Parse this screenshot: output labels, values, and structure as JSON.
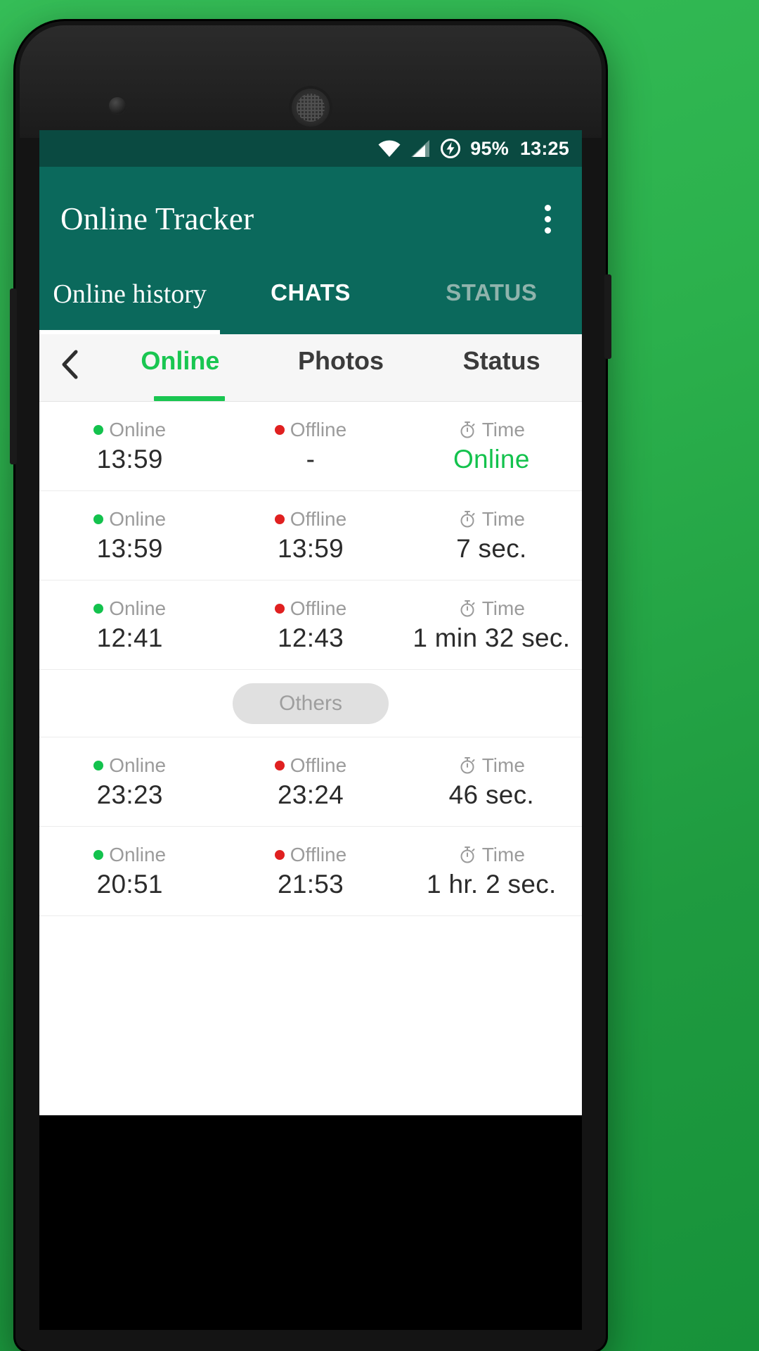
{
  "status_bar": {
    "wifi_icon": "wifi-icon",
    "signal_icon": "cellular-signal-icon",
    "charging_icon": "battery-charging-icon",
    "battery_percent": "95%",
    "clock": "13:25"
  },
  "app_bar": {
    "title": "Online Tracker",
    "overflow_icon": "overflow-menu-icon"
  },
  "primary_tabs": {
    "items": [
      {
        "label": "Online history",
        "active": true
      },
      {
        "label": "CHATS",
        "active": false
      },
      {
        "label": "STATUS",
        "active": false
      }
    ]
  },
  "sub_tabs": {
    "back_icon": "back-chevron-icon",
    "items": [
      {
        "label": "Online",
        "active": true
      },
      {
        "label": "Photos",
        "active": false
      },
      {
        "label": "Status",
        "active": false
      }
    ]
  },
  "columns": {
    "online_label": "Online",
    "offline_label": "Offline",
    "time_label": "Time",
    "online_icon": "green-dot-icon",
    "offline_icon": "red-dot-icon",
    "time_icon": "stopwatch-icon"
  },
  "history": {
    "rows": [
      {
        "online": "13:59",
        "offline": "-",
        "duration": "Online",
        "duration_is_live": true
      },
      {
        "online": "13:59",
        "offline": "13:59",
        "duration": "7 sec.",
        "duration_is_live": false
      },
      {
        "online": "12:41",
        "offline": "12:43",
        "duration": "1 min 32 sec.",
        "duration_is_live": false
      }
    ],
    "others_label": "Others",
    "other_rows": [
      {
        "online": "23:23",
        "offline": "23:24",
        "duration": "46 sec.",
        "duration_is_live": false
      },
      {
        "online": "20:51",
        "offline": "21:53",
        "duration": "1 hr. 2 sec.",
        "duration_is_live": false
      }
    ]
  },
  "colors": {
    "background_green": "#2bb04c",
    "app_bar_teal": "#0b695c",
    "status_bar_teal": "#0a4a41",
    "accent_green": "#13c24d",
    "offline_red": "#e02020",
    "muted_grey": "#9b9b9b"
  }
}
